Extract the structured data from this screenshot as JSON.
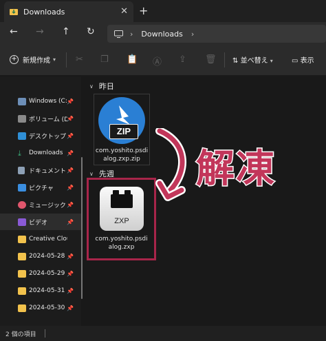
{
  "tab": {
    "title": "Downloads",
    "close": "✕",
    "new_tab": "+"
  },
  "nav": {
    "back": "←",
    "forward": "→",
    "up": "↑",
    "refresh": "↻"
  },
  "address": {
    "crumb": "Downloads",
    "sep1": "›",
    "sep2": "›"
  },
  "commandbar": {
    "new_label": "新規作成",
    "sort_label": "並べ替え",
    "view_label": "表示",
    "icons": [
      "cut-icon",
      "copy-icon",
      "paste-icon",
      "rename-icon",
      "share-icon",
      "delete-icon"
    ]
  },
  "sidebar": {
    "items": [
      {
        "label": "Windows (C:)",
        "icon": "drive-icon",
        "color": "#6d8fb8"
      },
      {
        "label": "ボリューム (D:)",
        "icon": "drive-icon",
        "color": "#8a8a8a"
      },
      {
        "label": "デスクトップ",
        "icon": "desktop-icon",
        "color": "#2f8fd6"
      },
      {
        "label": "Downloads",
        "icon": "download-icon",
        "color": "#3bb27a"
      },
      {
        "label": "ドキュメント",
        "icon": "document-icon",
        "color": "#8da0b5"
      },
      {
        "label": "ピクチャ",
        "icon": "picture-icon",
        "color": "#3a8ee0"
      },
      {
        "label": "ミュージック",
        "icon": "music-icon",
        "color": "#e0566c"
      },
      {
        "label": "ビデオ",
        "icon": "video-icon",
        "color": "#8a5ad6"
      },
      {
        "label": "Creative Clou",
        "icon": "cloud-folder-icon",
        "color": "#f2c24c"
      },
      {
        "label": "2024-05-28",
        "icon": "folder-icon",
        "color": "#f2c24c"
      },
      {
        "label": "2024-05-29",
        "icon": "folder-icon",
        "color": "#f2c24c"
      },
      {
        "label": "2024-05-31",
        "icon": "folder-icon",
        "color": "#f2c24c"
      },
      {
        "label": "2024-05-30",
        "icon": "folder-icon",
        "color": "#f2c24c"
      }
    ],
    "pin": "📌",
    "active_index": 7
  },
  "groups": {
    "yesterday": "昨日",
    "last_week": "先週"
  },
  "files": [
    {
      "name_line1": "com.yoshito.psdi",
      "name_line2": "alog.zxp.zip",
      "badge": "ZIP",
      "icon": "zip-archive-icon"
    },
    {
      "name_line1": "com.yoshito.psdi",
      "name_line2": "alog.zxp",
      "badge": "ZXP",
      "icon": "zxp-extension-icon"
    }
  ],
  "annotation": {
    "text": "解凍",
    "color": "#c2365a"
  },
  "status": {
    "count": "2 個の項目"
  }
}
